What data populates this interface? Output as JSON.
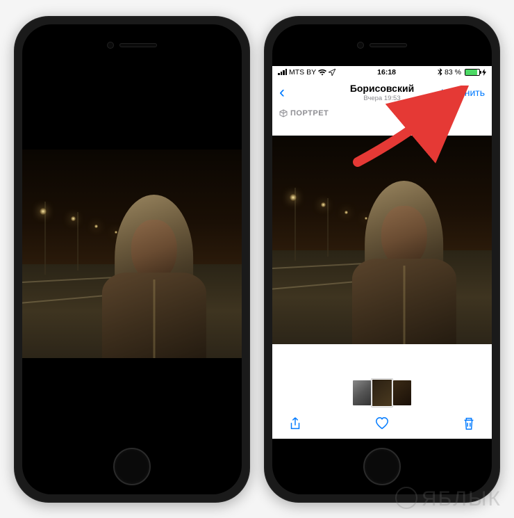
{
  "status_bar": {
    "carrier": "MTS BY",
    "time": "16:18",
    "battery_percent": "83 %"
  },
  "nav": {
    "title": "Борисовский",
    "subtitle": "Вчера 19:53",
    "edit_label": "Изменить"
  },
  "badges": {
    "portrait_label": "ПОРТРЕТ"
  },
  "watermark": "ЯБЛЫК"
}
